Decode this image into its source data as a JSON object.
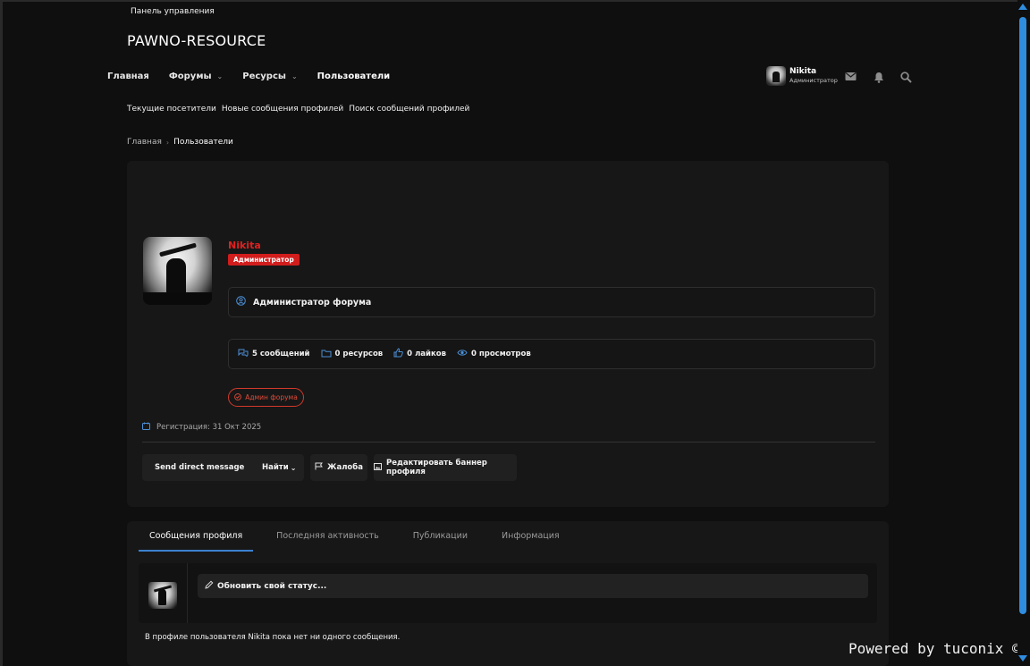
{
  "header": {
    "top_link": "Панель управления",
    "logo": "PAWNO-RESOURCE",
    "nav": [
      {
        "label": "Главная",
        "chevron": false
      },
      {
        "label": "Форумы",
        "chevron": true
      },
      {
        "label": "Ресурсы",
        "chevron": true
      },
      {
        "label": "Пользователи",
        "chevron": false
      }
    ],
    "user": {
      "name": "Nikita",
      "role": "Администратор"
    },
    "icons": [
      "envelope-icon",
      "bell-icon",
      "search-icon"
    ]
  },
  "subnav": [
    "Текущие посетители",
    "Новые сообщения профилей",
    "Поиск сообщений профилей"
  ],
  "breadcrumbs": [
    "Главная",
    "Пользователи"
  ],
  "profile": {
    "name": "Nikita",
    "role_badge": "Администратор",
    "title": "Администратор форума",
    "stats": [
      {
        "icon": "comments-icon",
        "value": "5",
        "label": "сообщений"
      },
      {
        "icon": "folder-icon",
        "value": "0",
        "label": "ресурсов"
      },
      {
        "icon": "thumbs-up-icon",
        "value": "0",
        "label": "лайков"
      },
      {
        "icon": "eye-icon",
        "value": "0",
        "label": "просмотров"
      }
    ],
    "admin_pill": "Админ форума",
    "registration": "Регистрация: 31 Окт 2025"
  },
  "actions": {
    "direct_message": "Send direct message",
    "find": "Найти",
    "report": "Жалоба",
    "edit_banner": "Редактировать баннер профиля"
  },
  "tabs": [
    "Сообщения профиля",
    "Последняя активность",
    "Публикации",
    "Информация"
  ],
  "status_placeholder": "Обновить свой статус...",
  "empty_message": "В профиле пользователя Nikita пока нет ни одного сообщения.",
  "powered_by": "Powered by tuconix ©",
  "colors": {
    "accent_blue": "#2f8de0",
    "admin_red": "#d21d1d",
    "background": "#0f0f0f",
    "panel": "#171717"
  }
}
